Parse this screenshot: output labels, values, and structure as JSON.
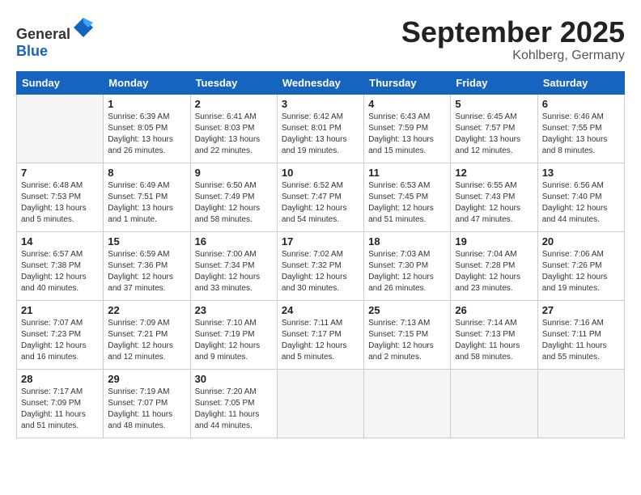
{
  "header": {
    "logo_general": "General",
    "logo_blue": "Blue",
    "month_title": "September 2025",
    "location": "Kohlberg, Germany"
  },
  "days_of_week": [
    "Sunday",
    "Monday",
    "Tuesday",
    "Wednesday",
    "Thursday",
    "Friday",
    "Saturday"
  ],
  "weeks": [
    [
      {
        "day": "",
        "sunrise": "",
        "sunset": "",
        "daylight": ""
      },
      {
        "day": "1",
        "sunrise": "Sunrise: 6:39 AM",
        "sunset": "Sunset: 8:05 PM",
        "daylight": "Daylight: 13 hours and 26 minutes."
      },
      {
        "day": "2",
        "sunrise": "Sunrise: 6:41 AM",
        "sunset": "Sunset: 8:03 PM",
        "daylight": "Daylight: 13 hours and 22 minutes."
      },
      {
        "day": "3",
        "sunrise": "Sunrise: 6:42 AM",
        "sunset": "Sunset: 8:01 PM",
        "daylight": "Daylight: 13 hours and 19 minutes."
      },
      {
        "day": "4",
        "sunrise": "Sunrise: 6:43 AM",
        "sunset": "Sunset: 7:59 PM",
        "daylight": "Daylight: 13 hours and 15 minutes."
      },
      {
        "day": "5",
        "sunrise": "Sunrise: 6:45 AM",
        "sunset": "Sunset: 7:57 PM",
        "daylight": "Daylight: 13 hours and 12 minutes."
      },
      {
        "day": "6",
        "sunrise": "Sunrise: 6:46 AM",
        "sunset": "Sunset: 7:55 PM",
        "daylight": "Daylight: 13 hours and 8 minutes."
      }
    ],
    [
      {
        "day": "7",
        "sunrise": "Sunrise: 6:48 AM",
        "sunset": "Sunset: 7:53 PM",
        "daylight": "Daylight: 13 hours and 5 minutes."
      },
      {
        "day": "8",
        "sunrise": "Sunrise: 6:49 AM",
        "sunset": "Sunset: 7:51 PM",
        "daylight": "Daylight: 13 hours and 1 minute."
      },
      {
        "day": "9",
        "sunrise": "Sunrise: 6:50 AM",
        "sunset": "Sunset: 7:49 PM",
        "daylight": "Daylight: 12 hours and 58 minutes."
      },
      {
        "day": "10",
        "sunrise": "Sunrise: 6:52 AM",
        "sunset": "Sunset: 7:47 PM",
        "daylight": "Daylight: 12 hours and 54 minutes."
      },
      {
        "day": "11",
        "sunrise": "Sunrise: 6:53 AM",
        "sunset": "Sunset: 7:45 PM",
        "daylight": "Daylight: 12 hours and 51 minutes."
      },
      {
        "day": "12",
        "sunrise": "Sunrise: 6:55 AM",
        "sunset": "Sunset: 7:43 PM",
        "daylight": "Daylight: 12 hours and 47 minutes."
      },
      {
        "day": "13",
        "sunrise": "Sunrise: 6:56 AM",
        "sunset": "Sunset: 7:40 PM",
        "daylight": "Daylight: 12 hours and 44 minutes."
      }
    ],
    [
      {
        "day": "14",
        "sunrise": "Sunrise: 6:57 AM",
        "sunset": "Sunset: 7:38 PM",
        "daylight": "Daylight: 12 hours and 40 minutes."
      },
      {
        "day": "15",
        "sunrise": "Sunrise: 6:59 AM",
        "sunset": "Sunset: 7:36 PM",
        "daylight": "Daylight: 12 hours and 37 minutes."
      },
      {
        "day": "16",
        "sunrise": "Sunrise: 7:00 AM",
        "sunset": "Sunset: 7:34 PM",
        "daylight": "Daylight: 12 hours and 33 minutes."
      },
      {
        "day": "17",
        "sunrise": "Sunrise: 7:02 AM",
        "sunset": "Sunset: 7:32 PM",
        "daylight": "Daylight: 12 hours and 30 minutes."
      },
      {
        "day": "18",
        "sunrise": "Sunrise: 7:03 AM",
        "sunset": "Sunset: 7:30 PM",
        "daylight": "Daylight: 12 hours and 26 minutes."
      },
      {
        "day": "19",
        "sunrise": "Sunrise: 7:04 AM",
        "sunset": "Sunset: 7:28 PM",
        "daylight": "Daylight: 12 hours and 23 minutes."
      },
      {
        "day": "20",
        "sunrise": "Sunrise: 7:06 AM",
        "sunset": "Sunset: 7:26 PM",
        "daylight": "Daylight: 12 hours and 19 minutes."
      }
    ],
    [
      {
        "day": "21",
        "sunrise": "Sunrise: 7:07 AM",
        "sunset": "Sunset: 7:23 PM",
        "daylight": "Daylight: 12 hours and 16 minutes."
      },
      {
        "day": "22",
        "sunrise": "Sunrise: 7:09 AM",
        "sunset": "Sunset: 7:21 PM",
        "daylight": "Daylight: 12 hours and 12 minutes."
      },
      {
        "day": "23",
        "sunrise": "Sunrise: 7:10 AM",
        "sunset": "Sunset: 7:19 PM",
        "daylight": "Daylight: 12 hours and 9 minutes."
      },
      {
        "day": "24",
        "sunrise": "Sunrise: 7:11 AM",
        "sunset": "Sunset: 7:17 PM",
        "daylight": "Daylight: 12 hours and 5 minutes."
      },
      {
        "day": "25",
        "sunrise": "Sunrise: 7:13 AM",
        "sunset": "Sunset: 7:15 PM",
        "daylight": "Daylight: 12 hours and 2 minutes."
      },
      {
        "day": "26",
        "sunrise": "Sunrise: 7:14 AM",
        "sunset": "Sunset: 7:13 PM",
        "daylight": "Daylight: 11 hours and 58 minutes."
      },
      {
        "day": "27",
        "sunrise": "Sunrise: 7:16 AM",
        "sunset": "Sunset: 7:11 PM",
        "daylight": "Daylight: 11 hours and 55 minutes."
      }
    ],
    [
      {
        "day": "28",
        "sunrise": "Sunrise: 7:17 AM",
        "sunset": "Sunset: 7:09 PM",
        "daylight": "Daylight: 11 hours and 51 minutes."
      },
      {
        "day": "29",
        "sunrise": "Sunrise: 7:19 AM",
        "sunset": "Sunset: 7:07 PM",
        "daylight": "Daylight: 11 hours and 48 minutes."
      },
      {
        "day": "30",
        "sunrise": "Sunrise: 7:20 AM",
        "sunset": "Sunset: 7:05 PM",
        "daylight": "Daylight: 11 hours and 44 minutes."
      },
      {
        "day": "",
        "sunrise": "",
        "sunset": "",
        "daylight": ""
      },
      {
        "day": "",
        "sunrise": "",
        "sunset": "",
        "daylight": ""
      },
      {
        "day": "",
        "sunrise": "",
        "sunset": "",
        "daylight": ""
      },
      {
        "day": "",
        "sunrise": "",
        "sunset": "",
        "daylight": ""
      }
    ]
  ]
}
